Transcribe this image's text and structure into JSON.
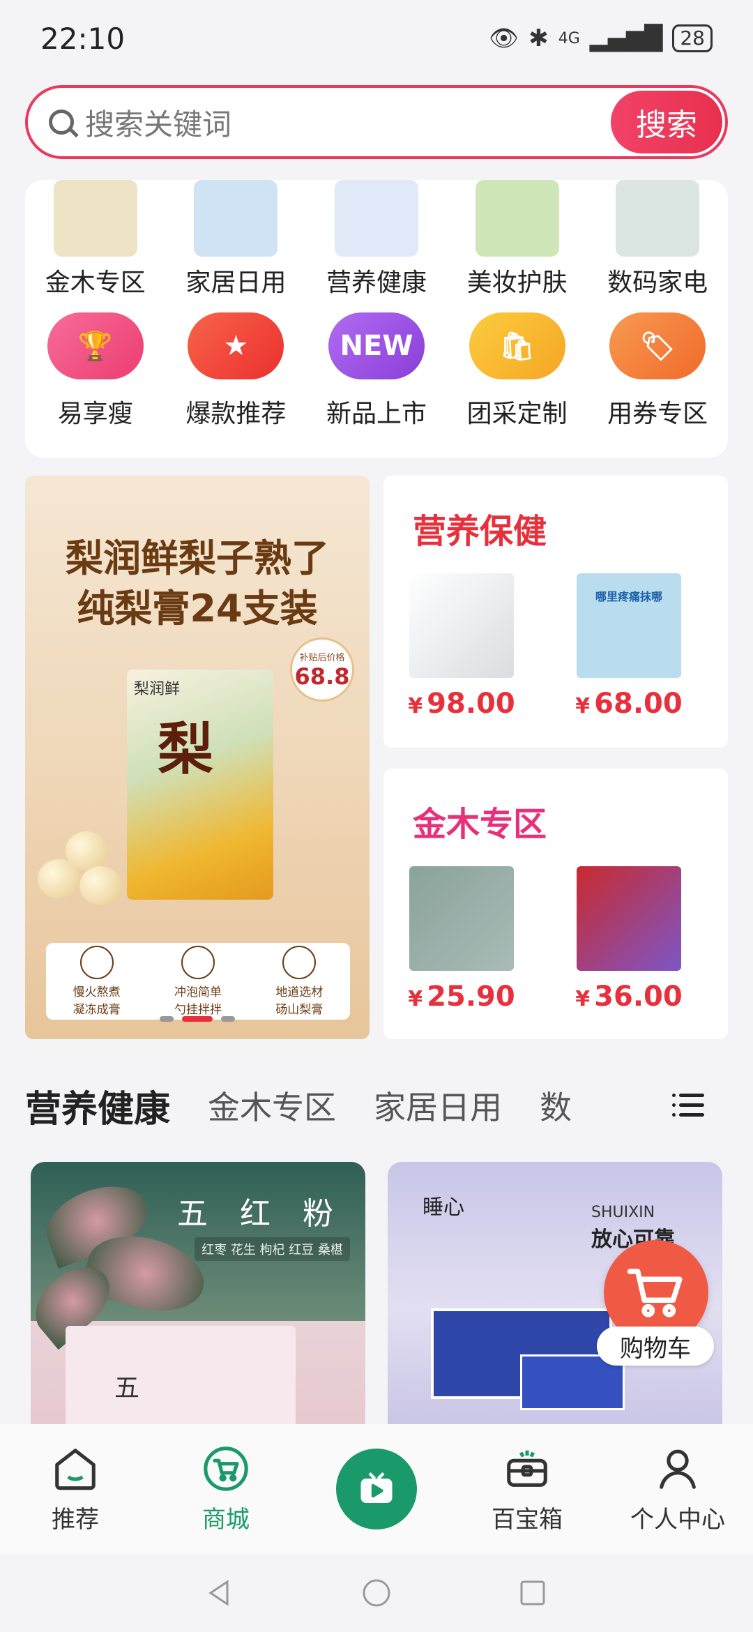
{
  "status": {
    "time": "22:10",
    "network": "4G",
    "battery": "28"
  },
  "search": {
    "placeholder": "搜索关键词",
    "button": "搜索"
  },
  "categories_row1": [
    {
      "label": "金木专区",
      "color": "#e8d8b2"
    },
    {
      "label": "家居日用",
      "color": "#cfe3f4"
    },
    {
      "label": "营养健康",
      "color": "#dfe9f7"
    },
    {
      "label": "美妆护肤",
      "color": "#cfe7b8"
    },
    {
      "label": "数码家电",
      "color": "#dbe6e3"
    }
  ],
  "categories_row2": [
    {
      "label": "易享瘦",
      "color": "#f0497d",
      "icon": "trophy-icon"
    },
    {
      "label": "爆款推荐",
      "color": "#f2443a",
      "icon": "star-badge-icon"
    },
    {
      "label": "新品上市",
      "color": "#9a4ee0",
      "icon": "new-badge-icon",
      "badge": "NEW"
    },
    {
      "label": "团采定制",
      "color": "#f8b72a",
      "icon": "shopping-bag-icon"
    },
    {
      "label": "用券专区",
      "color": "#f57c3c",
      "icon": "tag-icon"
    }
  ],
  "banner": {
    "line1": "梨润鲜梨子熟了",
    "line2": "纯梨膏24支装",
    "brand": "梨润鲜",
    "big_char": "梨",
    "price_label": "补贴后价格",
    "price_value": "68.8",
    "features": [
      "慢火熬煮",
      "冲泡简单",
      "地道选材"
    ],
    "feature_subs": [
      "凝冻成膏",
      "勺挂拌拌",
      "砀山梨膏"
    ]
  },
  "promo1": {
    "title": "营养保健",
    "title_color": "#e8303c",
    "items": [
      {
        "price": "98.00",
        "image_color": "#e9ecef"
      },
      {
        "price": "68.00",
        "image_color": "#b9dcef",
        "image_text": "哪里疼痛抹哪"
      }
    ]
  },
  "promo2": {
    "title": "金木专区",
    "title_color": "#e8307a",
    "items": [
      {
        "price": "25.90",
        "image_color": "#93a8a3"
      },
      {
        "price": "36.00",
        "image_color": "#d7363a"
      }
    ]
  },
  "currency": "¥",
  "tabs": [
    "营养健康",
    "金木专区",
    "家居日用",
    "数"
  ],
  "product_left": {
    "title": "五 红 粉",
    "subtitle": "红枣 花生 枸杞 红豆 桑椹",
    "box_text": "五"
  },
  "product_right": {
    "brand": "睡心",
    "title": "SHUIXIN",
    "slogan": "放心可靠"
  },
  "cart_fab": {
    "label": "购物车"
  },
  "bottom_nav": [
    {
      "label": "推荐",
      "icon": "home-icon"
    },
    {
      "label": "商城",
      "icon": "cart-icon",
      "active": true
    },
    {
      "label": "",
      "icon": "tv-play-icon"
    },
    {
      "label": "百宝箱",
      "icon": "treasure-box-icon"
    },
    {
      "label": "个人中心",
      "icon": "user-icon"
    }
  ]
}
